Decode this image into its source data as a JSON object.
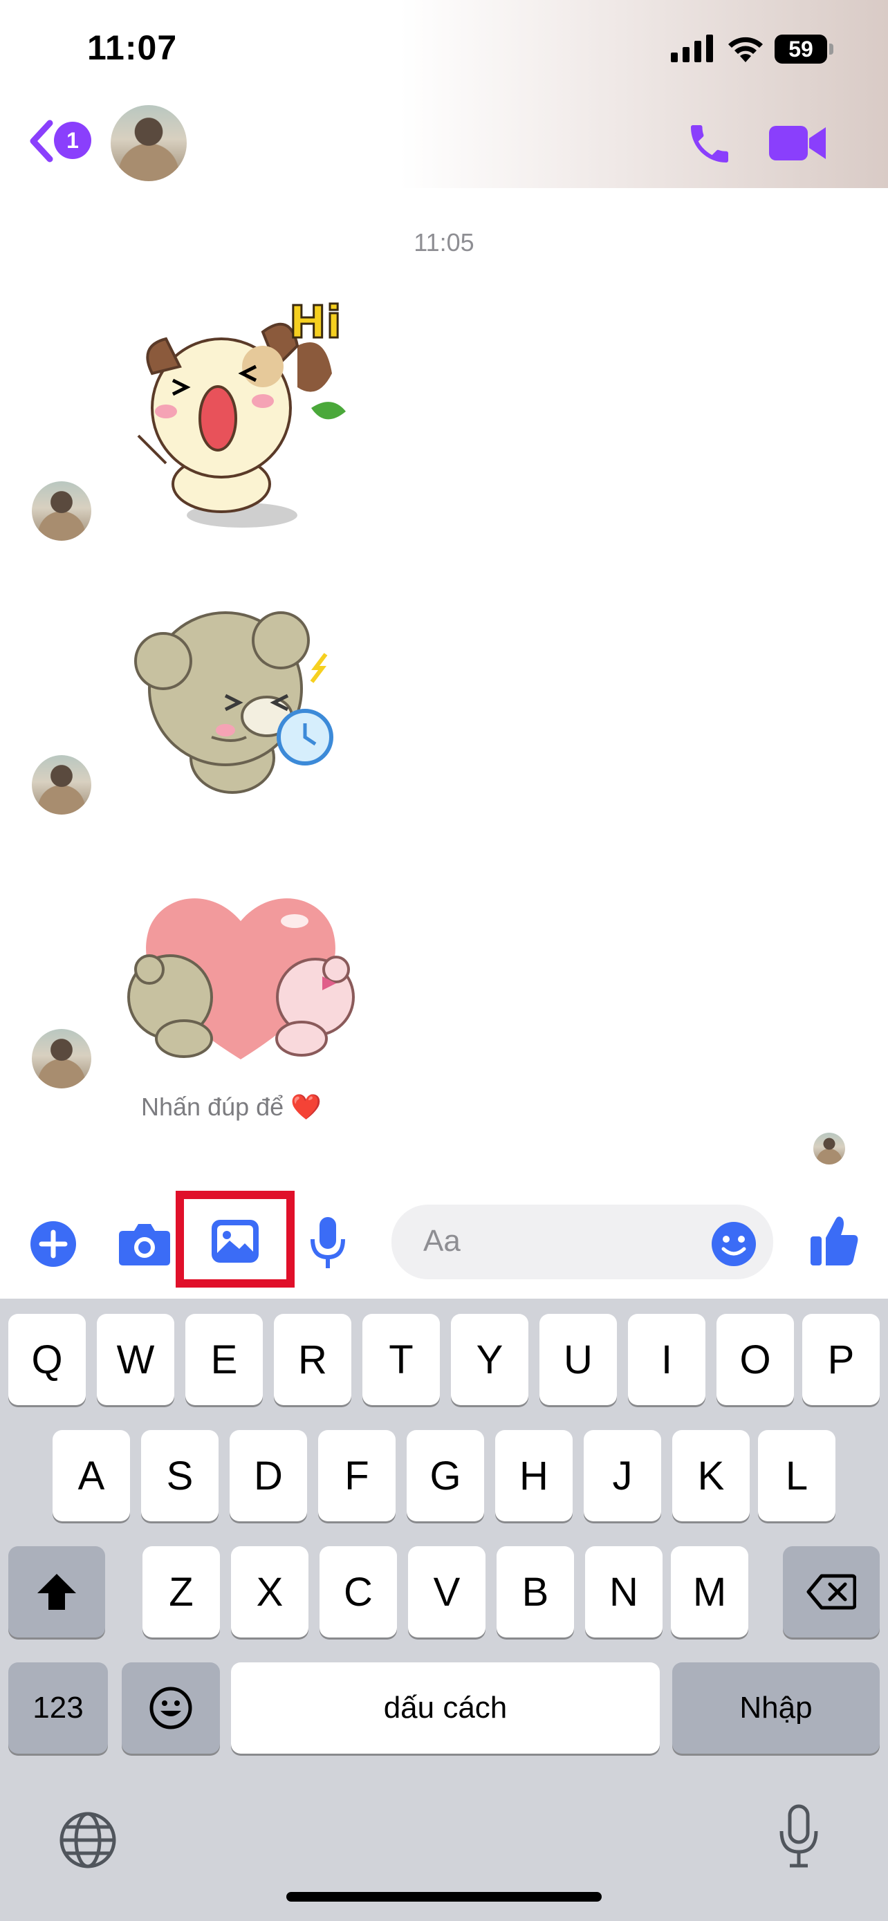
{
  "status_bar": {
    "time": "11:07",
    "battery": "59"
  },
  "header": {
    "unread_count": "1",
    "contact_name": ""
  },
  "conversation": {
    "timestamp": "11:05",
    "stickers": [
      {
        "name": "puppy-hi-sticker",
        "text": "Hi"
      },
      {
        "name": "bear-alarm-sticker",
        "text": ""
      },
      {
        "name": "bears-heart-sticker",
        "text": ""
      }
    ],
    "reaction_hint": "Nhấn đúp để ❤️"
  },
  "composer": {
    "placeholder": "Aa"
  },
  "keyboard": {
    "row1": [
      "Q",
      "W",
      "E",
      "R",
      "T",
      "Y",
      "U",
      "I",
      "O",
      "P"
    ],
    "row2": [
      "A",
      "S",
      "D",
      "F",
      "G",
      "H",
      "J",
      "K",
      "L"
    ],
    "row3": [
      "Z",
      "X",
      "C",
      "V",
      "B",
      "N",
      "M"
    ],
    "numbers_key": "123",
    "space_key": "dấu cách",
    "return_key": "Nhập"
  },
  "colors": {
    "accent": "#8a3ffc",
    "composer_icon": "#3b6cf6",
    "highlight": "#e0102a"
  }
}
